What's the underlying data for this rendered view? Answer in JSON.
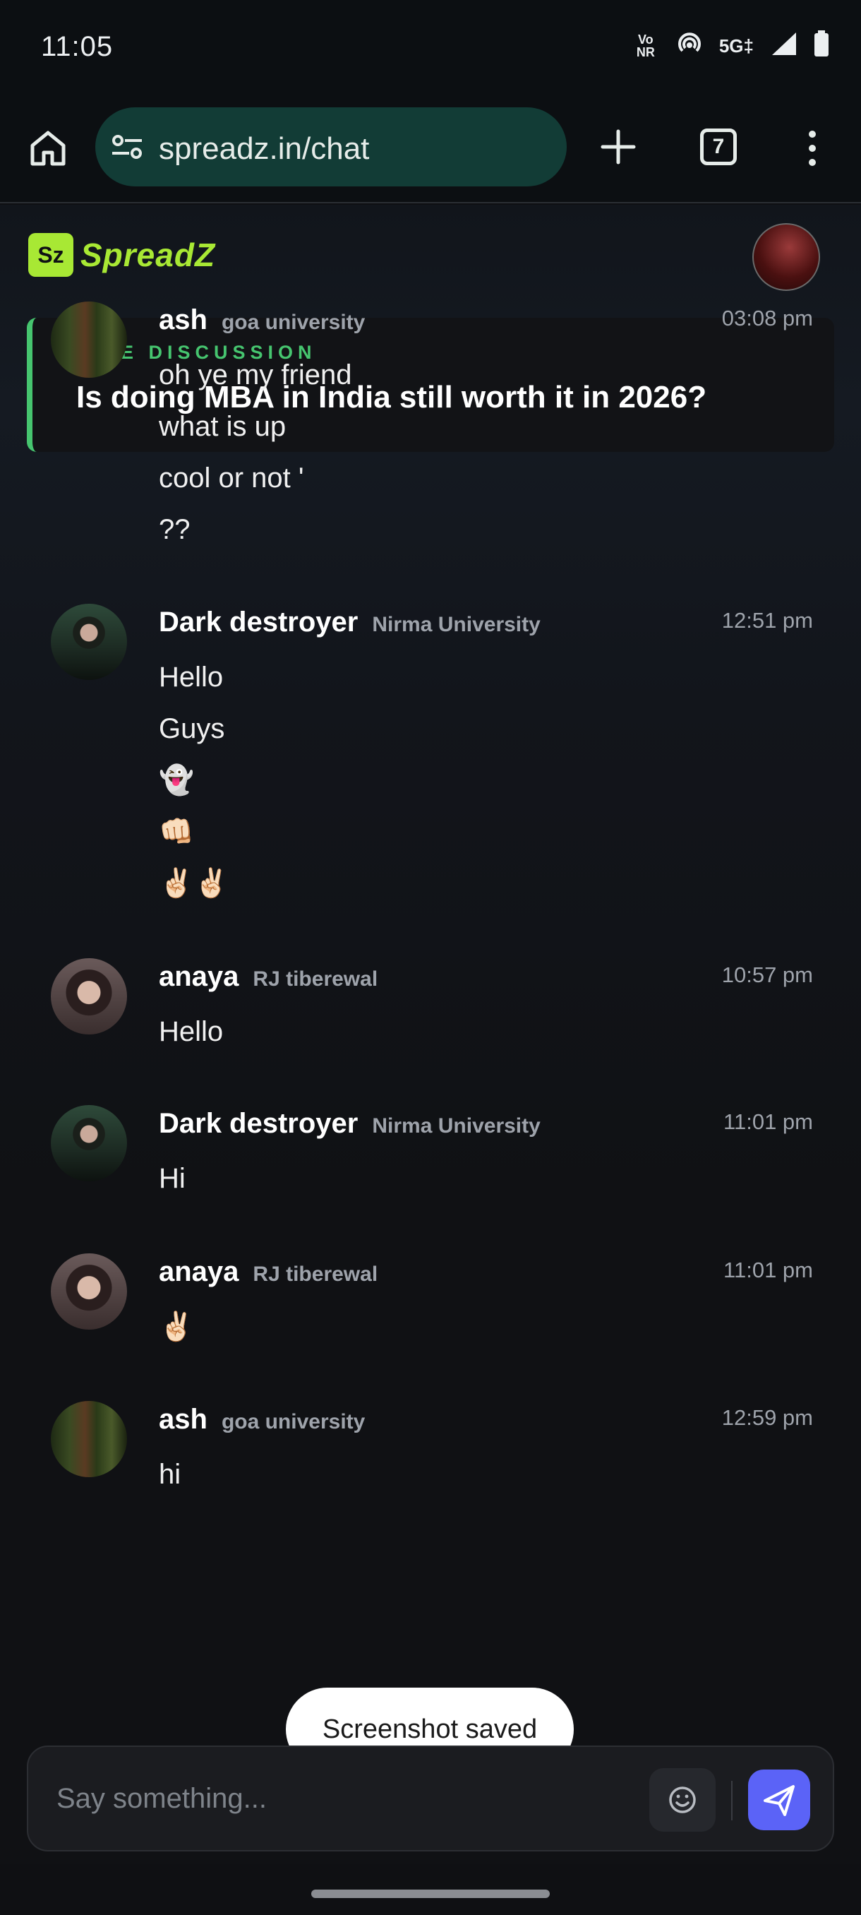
{
  "status_bar": {
    "time": "11:05",
    "icons": [
      "volte-icon",
      "hotspot-icon",
      "5g-icon",
      "signal-icon",
      "battery-icon"
    ],
    "network": "5G‡",
    "volte": "Vo NR"
  },
  "browser": {
    "url": "spreadz.in/chat",
    "tab_count": "7"
  },
  "app": {
    "brand_mark": "Sz",
    "brand_name": "SpreadZ",
    "live": {
      "label": "LIVE DISCUSSION",
      "title": "Is doing MBA in India still worth it in 2026?"
    },
    "messages": [
      {
        "name": "ash",
        "university": "goa university",
        "time": "03:08 pm",
        "avatar": "forest",
        "lines": [
          "oh ye my friend",
          "what is up",
          "cool or not '",
          "??"
        ]
      },
      {
        "name": "Dark destroyer",
        "university": "Nirma University",
        "time": "12:51 pm",
        "avatar": "man",
        "lines": [
          "Hello",
          "Guys",
          "👻",
          "👊🏻",
          "✌🏻✌🏻"
        ]
      },
      {
        "name": "anaya",
        "university": "RJ tiberewal",
        "time": "10:57 pm",
        "avatar": "girl",
        "lines": [
          "Hello"
        ]
      },
      {
        "name": "Dark destroyer",
        "university": "Nirma University",
        "time": "11:01 pm",
        "avatar": "man",
        "lines": [
          "Hi"
        ]
      },
      {
        "name": "anaya",
        "university": "RJ tiberewal",
        "time": "11:01 pm",
        "avatar": "girl",
        "lines": [
          "✌🏻"
        ]
      },
      {
        "name": "ash",
        "university": "goa university",
        "time": "12:59 pm",
        "avatar": "forest",
        "lines": [
          "hi"
        ]
      }
    ],
    "composer": {
      "placeholder": "Say something..."
    }
  },
  "toast": "Screenshot saved",
  "colors": {
    "accent_green": "#a8e834",
    "live_green": "#46c56f",
    "send_blue": "#5b63f7",
    "url_bar": "#123c36"
  }
}
